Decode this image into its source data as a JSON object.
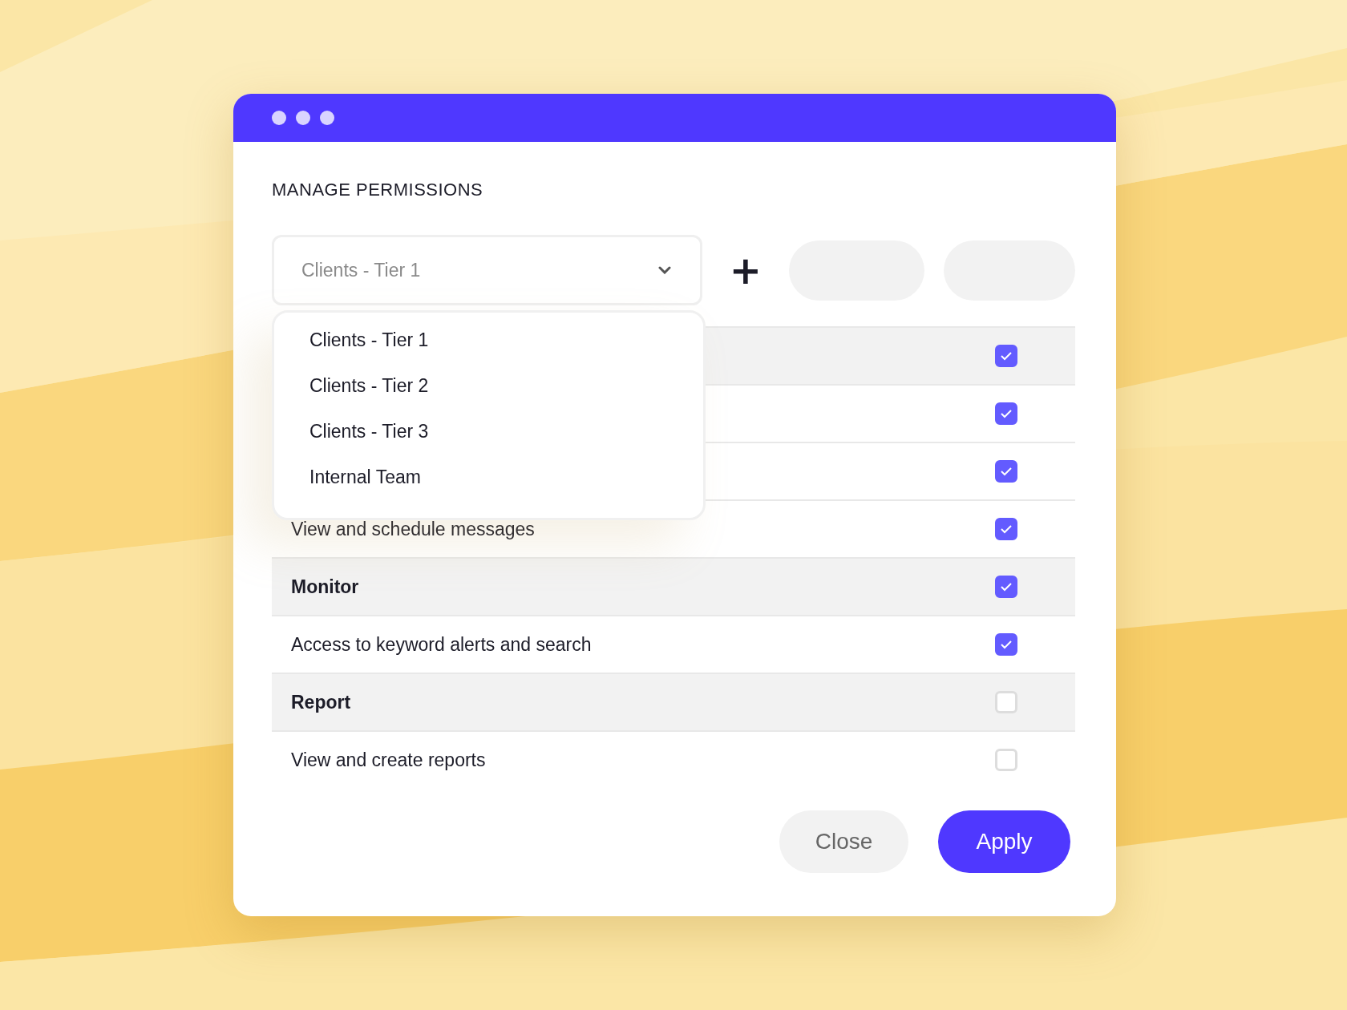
{
  "window": {
    "title": "MANAGE PERMISSIONS"
  },
  "group_select": {
    "value": "Clients - Tier 1",
    "options": [
      "Clients - Tier 1",
      "Clients - Tier 2",
      "Clients - Tier 3",
      "Internal Team"
    ]
  },
  "add_button": {
    "label": "+"
  },
  "rows": [
    {
      "kind": "group",
      "checked": true
    },
    {
      "kind": "item",
      "checked": true
    },
    {
      "kind": "item",
      "checked": true
    },
    {
      "kind": "item",
      "label": "View and schedule messages",
      "checked": true
    },
    {
      "kind": "group",
      "label": "Monitor",
      "checked": true
    },
    {
      "kind": "item",
      "label": "Access to keyword alerts and search",
      "checked": true
    },
    {
      "kind": "group",
      "label": "Report",
      "checked": false
    },
    {
      "kind": "item",
      "label": "View and create reports",
      "checked": false
    }
  ],
  "buttons": [
    {
      "kind": "secondary",
      "label": "Close"
    },
    {
      "kind": "primary",
      "label": "Apply"
    }
  ]
}
